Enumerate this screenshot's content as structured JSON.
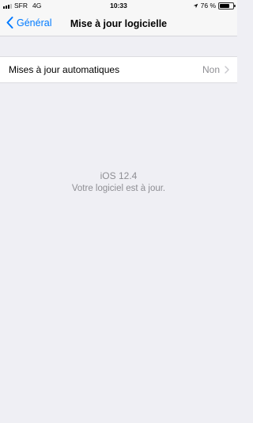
{
  "status_bar": {
    "carrier": "SFR",
    "network": "4G",
    "time": "10:33",
    "battery_percent": "76 %",
    "battery_level": 0.76
  },
  "nav": {
    "back_label": "Général",
    "title": "Mise à jour logicielle"
  },
  "settings": {
    "auto_updates": {
      "label": "Mises à jour automatiques",
      "value": "Non"
    }
  },
  "info": {
    "version": "iOS 12.4",
    "message": "Votre logiciel est à jour."
  },
  "colors": {
    "accent": "#007aff",
    "secondary_text": "#8e8e93",
    "background": "#efeff4"
  }
}
